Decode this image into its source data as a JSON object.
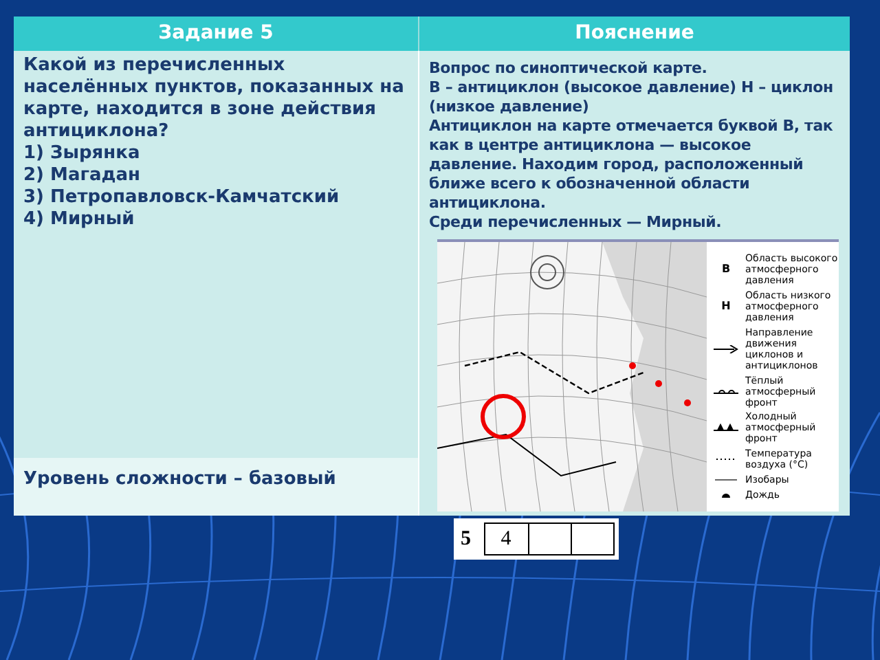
{
  "table": {
    "columns": [
      "Задание 5",
      "Пояснение"
    ],
    "question": {
      "text": "Какой из перечисленных населённых пунктов, показанных на карте, находится в зоне действия антициклона?",
      "options": [
        "1) Зырянка",
        "2) Магадан",
        "3) Петропавловск-Камчатский",
        "4) Мирный"
      ]
    },
    "explanation": [
      "Вопрос по синоптической карте.",
      "В – антициклон (высокое давление) Н – циклон (низкое давление)",
      "Антициклон на карте отмечается буквой В, так как в центре антициклона — высокое давление. Находим город, расположенный ближе всего к обозначенной области антициклона.",
      "Среди перечисленных — Мирный."
    ],
    "level": "Уровень сложности – базовый",
    "map_legend": [
      {
        "kind": "letter",
        "symbol": "В",
        "label": "Область высокого атмосферного давления"
      },
      {
        "kind": "letter",
        "symbol": "Н",
        "label": "Область низкого атмосферного давления"
      },
      {
        "kind": "arrow",
        "label": "Направление движения циклонов и антициклонов"
      },
      {
        "kind": "warm",
        "label": "Тёплый атмосферный фронт"
      },
      {
        "kind": "cold",
        "label": "Холодный атмосферный фронт"
      },
      {
        "kind": "temp",
        "label": "Температура воздуха (°С)"
      },
      {
        "kind": "line",
        "label": "Изобары"
      },
      {
        "kind": "rain",
        "label": "Дождь"
      }
    ]
  },
  "answer": {
    "number": "5",
    "cells": [
      "4"
    ]
  }
}
